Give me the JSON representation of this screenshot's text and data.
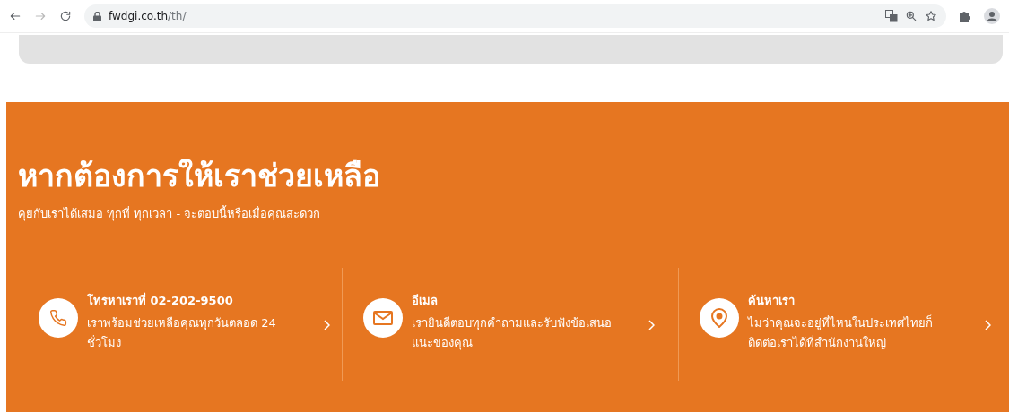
{
  "browser": {
    "url_host": "fwdgi.co.th",
    "url_path": "/th/"
  },
  "help": {
    "title": "หากต้องการให้เราช่วยเหลือ",
    "subtitle": "คุยกับเราได้เสมอ ทุกที่ ทุกเวลา - จะตอบนี้หรือเมื่อคุณสะดวก",
    "cards": [
      {
        "kind": "phone",
        "title": "โทรหาเราที่ 02-202-9500",
        "description": "เราพร้อมช่วยเหลือคุณทุกวันตลอด 24 ชั่วโมง"
      },
      {
        "kind": "email",
        "title": "อีเมล",
        "description": "เรายินดีตอบทุกคำถามและรับฟังข้อเสนอแนะของคุณ"
      },
      {
        "kind": "location",
        "title": "ค้นหาเรา",
        "description": "ไม่ว่าคุณจะอยู่ที่ไหนในประเทศไทยก็ติดต่อเราได้ที่สำนักงานใหญ่"
      }
    ]
  }
}
